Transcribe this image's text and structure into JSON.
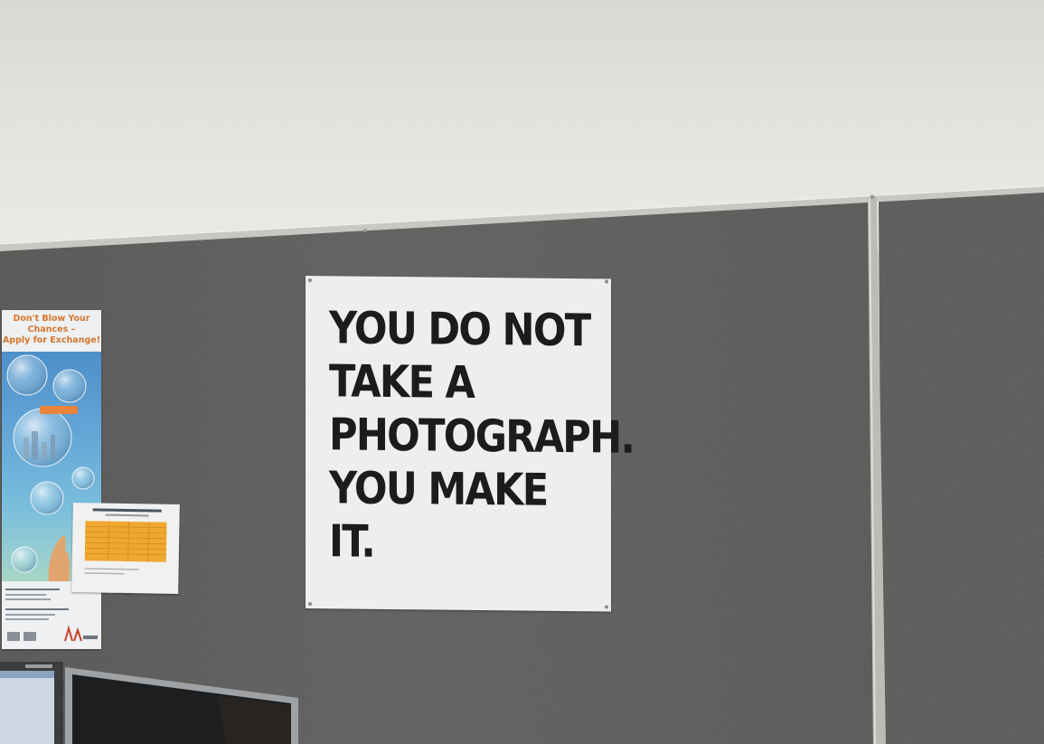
{
  "quote_poster": {
    "lines": [
      "YOU DO NOT",
      "TAKE A",
      "PHOTOGRAPH.",
      "YOU MAKE",
      "IT."
    ]
  },
  "exchange_poster": {
    "headline_lines": [
      "Don't Blow Your",
      "Chances –",
      "Apply for Exchange!"
    ]
  },
  "colors": {
    "wall": "#e6e4e0",
    "fabric_board": "#5a5856",
    "poster_bg": "#efeeec",
    "quote_text": "#1c1c1c",
    "exchange_headline": "#d4762e"
  }
}
